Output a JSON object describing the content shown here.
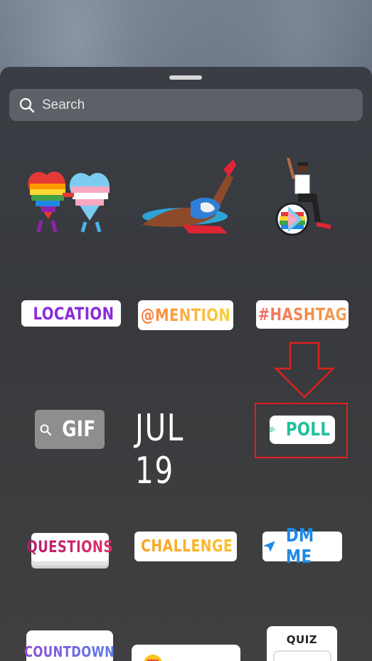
{
  "search": {
    "placeholder": "Search"
  },
  "stickers": {
    "location": "LOCATION",
    "mention": "@MENTION",
    "hashtag": "#HASHTAG",
    "gif": "GIF",
    "date": "JUL 19",
    "poll": "POLL",
    "questions": "QUESTIONS",
    "challenge": "CHALLENGE",
    "dm": "DM ME",
    "countdown": "COUNTDOWN",
    "quiz": "QUIZ"
  },
  "colors": {
    "highlight": "#e02020",
    "poll_accent": "#1fc19a",
    "location_accent": "#8a2bd9",
    "dm_accent": "#1e88e5"
  }
}
